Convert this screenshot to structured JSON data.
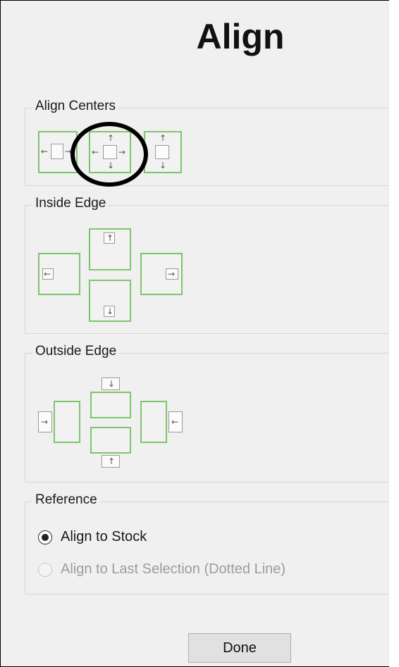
{
  "dialog": {
    "title": "Align"
  },
  "groups": {
    "align_centers": {
      "label": "Align Centers",
      "buttons": [
        "center-horizontal",
        "center-both",
        "center-vertical"
      ]
    },
    "inside_edge": {
      "label": "Inside Edge",
      "buttons": [
        "inside-left",
        "inside-top",
        "inside-bottom",
        "inside-right"
      ]
    },
    "outside_edge": {
      "label": "Outside Edge",
      "buttons": [
        "outside-left",
        "outside-top",
        "outside-bottom",
        "outside-right"
      ]
    },
    "reference": {
      "label": "Reference",
      "options": [
        {
          "label": "Align to Stock",
          "selected": true,
          "enabled": true
        },
        {
          "label": "Align to Last Selection (Dotted Line)",
          "selected": false,
          "enabled": false
        }
      ]
    }
  },
  "footer": {
    "done_label": "Done"
  },
  "colors": {
    "accent_green": "#7dc56d",
    "background": "#f0f0f0"
  },
  "annotation": {
    "highlighted_button": "center-both"
  }
}
